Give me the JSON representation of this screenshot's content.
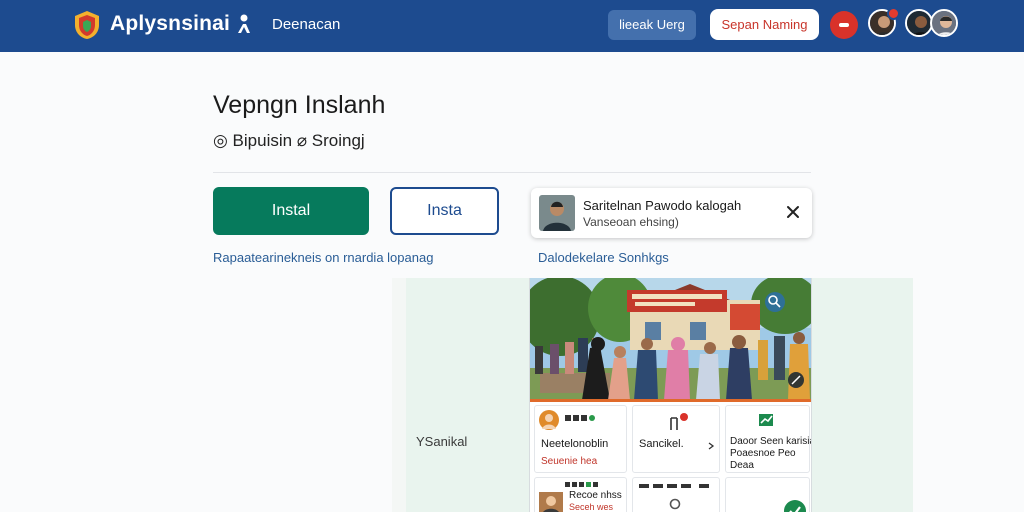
{
  "header": {
    "brand": "Aplysnsinai",
    "nav_link": "Deenacan",
    "secondary_button": "lieeak Uerg",
    "primary_button": "Sepan Naming"
  },
  "page": {
    "title": "Vepngn Inslanh",
    "meta": "◎ Bipuisin ⌀ Sroingj",
    "install_button": "Instal",
    "install_outline_button": "Insta",
    "link_left": "Rapaatearinekneis on rnardia lopanag",
    "link_right": "Dalodekelare Sonhkgs"
  },
  "toast": {
    "title": "Saritelnan Pawodo kalogah",
    "subtitle": "Vanseoan ehsing)"
  },
  "preview": {
    "side_label": "YSanikal",
    "cards": [
      {
        "line1": "Neetelonoblin",
        "line2": "Seuenie hea"
      },
      {
        "line1": "Sancikel.",
        "line2": ""
      },
      {
        "line1": "Daoor Seen karisia",
        "line2": "Poaesnoe Peo",
        "line3": "Deaa"
      },
      {
        "line1": "Recoe nhss",
        "line2": "Seceh wes"
      }
    ]
  },
  "colors": {
    "header_bg": "#1d4b8f",
    "install_green": "#067a5c",
    "accent_red": "#d9322a",
    "link_blue": "#2a5d96"
  }
}
